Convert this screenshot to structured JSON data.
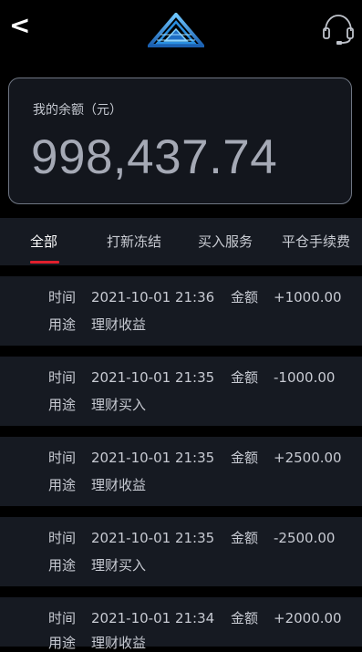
{
  "header": {
    "back_label": "<",
    "logo_icon": "triangle-logo-icon",
    "support_icon": "headset-icon"
  },
  "balance": {
    "label": "我的余额（元）",
    "value": "998,437.74"
  },
  "tabs": [
    {
      "label": "全部",
      "active": true
    },
    {
      "label": "打新冻结",
      "active": false
    },
    {
      "label": "买入服务",
      "active": false
    },
    {
      "label": "平仓手续费",
      "active": false
    }
  ],
  "records": [
    {
      "time_label": "时间",
      "time": "2021-10-01 21:36",
      "amount_label": "金额",
      "amount": "+1000.00",
      "purpose_label": "用途",
      "purpose": "理财收益"
    },
    {
      "time_label": "时间",
      "time": "2021-10-01 21:35",
      "amount_label": "金额",
      "amount": "-1000.00",
      "purpose_label": "用途",
      "purpose": "理财买入"
    },
    {
      "time_label": "时间",
      "time": "2021-10-01 21:35",
      "amount_label": "金额",
      "amount": "+2500.00",
      "purpose_label": "用途",
      "purpose": "理财收益"
    },
    {
      "time_label": "时间",
      "time": "2021-10-01 21:35",
      "amount_label": "金额",
      "amount": "-2500.00",
      "purpose_label": "用途",
      "purpose": "理财买入"
    },
    {
      "time_label": "时间",
      "time": "2021-10-01 21:34",
      "amount_label": "金额",
      "amount": "+2000.00",
      "purpose_label": "用途",
      "purpose": "理财收益"
    }
  ],
  "colors": {
    "background": "#000000",
    "card": "#13161d",
    "row": "#161a22",
    "accent": "#e0202d",
    "logo": "#2a8fe0"
  }
}
